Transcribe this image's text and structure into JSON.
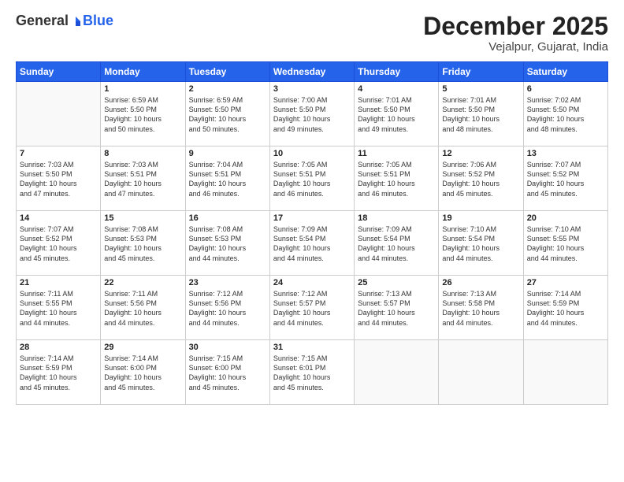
{
  "logo": {
    "general": "General",
    "blue": "Blue"
  },
  "header": {
    "month": "December 2025",
    "location": "Vejalpur, Gujarat, India"
  },
  "weekdays": [
    "Sunday",
    "Monday",
    "Tuesday",
    "Wednesday",
    "Thursday",
    "Friday",
    "Saturday"
  ],
  "weeks": [
    [
      {
        "day": "",
        "info": ""
      },
      {
        "day": "1",
        "info": "Sunrise: 6:59 AM\nSunset: 5:50 PM\nDaylight: 10 hours\nand 50 minutes."
      },
      {
        "day": "2",
        "info": "Sunrise: 6:59 AM\nSunset: 5:50 PM\nDaylight: 10 hours\nand 50 minutes."
      },
      {
        "day": "3",
        "info": "Sunrise: 7:00 AM\nSunset: 5:50 PM\nDaylight: 10 hours\nand 49 minutes."
      },
      {
        "day": "4",
        "info": "Sunrise: 7:01 AM\nSunset: 5:50 PM\nDaylight: 10 hours\nand 49 minutes."
      },
      {
        "day": "5",
        "info": "Sunrise: 7:01 AM\nSunset: 5:50 PM\nDaylight: 10 hours\nand 48 minutes."
      },
      {
        "day": "6",
        "info": "Sunrise: 7:02 AM\nSunset: 5:50 PM\nDaylight: 10 hours\nand 48 minutes."
      }
    ],
    [
      {
        "day": "7",
        "info": "Sunrise: 7:03 AM\nSunset: 5:50 PM\nDaylight: 10 hours\nand 47 minutes."
      },
      {
        "day": "8",
        "info": "Sunrise: 7:03 AM\nSunset: 5:51 PM\nDaylight: 10 hours\nand 47 minutes."
      },
      {
        "day": "9",
        "info": "Sunrise: 7:04 AM\nSunset: 5:51 PM\nDaylight: 10 hours\nand 46 minutes."
      },
      {
        "day": "10",
        "info": "Sunrise: 7:05 AM\nSunset: 5:51 PM\nDaylight: 10 hours\nand 46 minutes."
      },
      {
        "day": "11",
        "info": "Sunrise: 7:05 AM\nSunset: 5:51 PM\nDaylight: 10 hours\nand 46 minutes."
      },
      {
        "day": "12",
        "info": "Sunrise: 7:06 AM\nSunset: 5:52 PM\nDaylight: 10 hours\nand 45 minutes."
      },
      {
        "day": "13",
        "info": "Sunrise: 7:07 AM\nSunset: 5:52 PM\nDaylight: 10 hours\nand 45 minutes."
      }
    ],
    [
      {
        "day": "14",
        "info": "Sunrise: 7:07 AM\nSunset: 5:52 PM\nDaylight: 10 hours\nand 45 minutes."
      },
      {
        "day": "15",
        "info": "Sunrise: 7:08 AM\nSunset: 5:53 PM\nDaylight: 10 hours\nand 45 minutes."
      },
      {
        "day": "16",
        "info": "Sunrise: 7:08 AM\nSunset: 5:53 PM\nDaylight: 10 hours\nand 44 minutes."
      },
      {
        "day": "17",
        "info": "Sunrise: 7:09 AM\nSunset: 5:54 PM\nDaylight: 10 hours\nand 44 minutes."
      },
      {
        "day": "18",
        "info": "Sunrise: 7:09 AM\nSunset: 5:54 PM\nDaylight: 10 hours\nand 44 minutes."
      },
      {
        "day": "19",
        "info": "Sunrise: 7:10 AM\nSunset: 5:54 PM\nDaylight: 10 hours\nand 44 minutes."
      },
      {
        "day": "20",
        "info": "Sunrise: 7:10 AM\nSunset: 5:55 PM\nDaylight: 10 hours\nand 44 minutes."
      }
    ],
    [
      {
        "day": "21",
        "info": "Sunrise: 7:11 AM\nSunset: 5:55 PM\nDaylight: 10 hours\nand 44 minutes."
      },
      {
        "day": "22",
        "info": "Sunrise: 7:11 AM\nSunset: 5:56 PM\nDaylight: 10 hours\nand 44 minutes."
      },
      {
        "day": "23",
        "info": "Sunrise: 7:12 AM\nSunset: 5:56 PM\nDaylight: 10 hours\nand 44 minutes."
      },
      {
        "day": "24",
        "info": "Sunrise: 7:12 AM\nSunset: 5:57 PM\nDaylight: 10 hours\nand 44 minutes."
      },
      {
        "day": "25",
        "info": "Sunrise: 7:13 AM\nSunset: 5:57 PM\nDaylight: 10 hours\nand 44 minutes."
      },
      {
        "day": "26",
        "info": "Sunrise: 7:13 AM\nSunset: 5:58 PM\nDaylight: 10 hours\nand 44 minutes."
      },
      {
        "day": "27",
        "info": "Sunrise: 7:14 AM\nSunset: 5:59 PM\nDaylight: 10 hours\nand 44 minutes."
      }
    ],
    [
      {
        "day": "28",
        "info": "Sunrise: 7:14 AM\nSunset: 5:59 PM\nDaylight: 10 hours\nand 45 minutes."
      },
      {
        "day": "29",
        "info": "Sunrise: 7:14 AM\nSunset: 6:00 PM\nDaylight: 10 hours\nand 45 minutes."
      },
      {
        "day": "30",
        "info": "Sunrise: 7:15 AM\nSunset: 6:00 PM\nDaylight: 10 hours\nand 45 minutes."
      },
      {
        "day": "31",
        "info": "Sunrise: 7:15 AM\nSunset: 6:01 PM\nDaylight: 10 hours\nand 45 minutes."
      },
      {
        "day": "",
        "info": ""
      },
      {
        "day": "",
        "info": ""
      },
      {
        "day": "",
        "info": ""
      }
    ]
  ]
}
